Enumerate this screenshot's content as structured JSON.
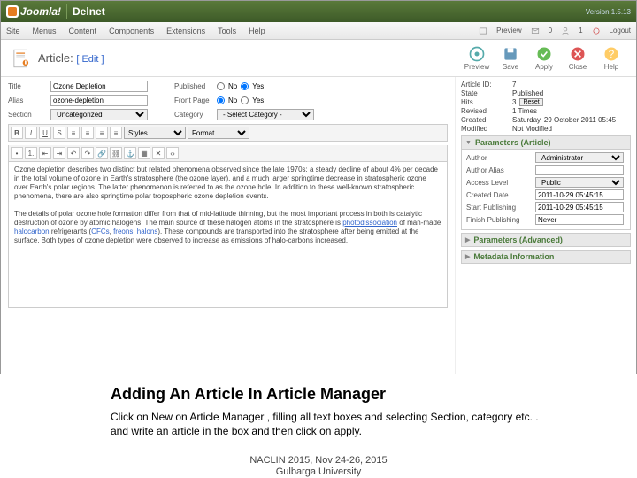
{
  "topbar": {
    "brand": "Joomla!",
    "brand2": "Delnet",
    "version": "Version 1.5.13"
  },
  "menubar": {
    "items": [
      "Site",
      "Menus",
      "Content",
      "Components",
      "Extensions",
      "Tools",
      "Help"
    ],
    "preview": "Preview",
    "msgcount": "0",
    "userscount": "1",
    "logout": "Logout"
  },
  "header": {
    "title": "Article:",
    "mode": "[ Edit ]"
  },
  "toolbar": {
    "preview": "Preview",
    "save": "Save",
    "apply": "Apply",
    "close": "Close",
    "help": "Help"
  },
  "fields": {
    "title_label": "Title",
    "title_value": "Ozone Depletion",
    "alias_label": "Alias",
    "alias_value": "ozone-depletion",
    "section_label": "Section",
    "section_value": "Uncategorized",
    "published_label": "Published",
    "frontpage_label": "Front Page",
    "category_label": "Category",
    "category_value": "- Select Category -",
    "no": "No",
    "yes": "Yes"
  },
  "meta": {
    "articleid_k": "Article ID:",
    "articleid_v": "7",
    "state_k": "State",
    "state_v": "Published",
    "hits_k": "Hits",
    "hits_v": "3",
    "reset": "Reset",
    "revised_k": "Revised",
    "revised_v": "1 Times",
    "created_k": "Created",
    "created_v": "Saturday, 29 October 2011 05:45",
    "modified_k": "Modified",
    "modified_v": "Not Modified"
  },
  "params": {
    "h1": "Parameters (Article)",
    "h2": "Parameters (Advanced)",
    "h3": "Metadata Information",
    "author_k": "Author",
    "author_v": "Administrator",
    "alias_k": "Author Alias",
    "alias_v": "",
    "access_k": "Access Level",
    "access_v": "Public",
    "created_k": "Created Date",
    "created_v": "2011-10-29 05:45:15",
    "start_k": "Start Publishing",
    "start_v": "2011-10-29 05:45:15",
    "finish_k": "Finish Publishing",
    "finish_v": "Never"
  },
  "editor": {
    "styles": "Styles",
    "format": "Format",
    "p1": "Ozone depletion describes two distinct but related phenomena observed since the late 1970s: a steady decline of about 4% per decade in the total volume of ozone in Earth's stratosphere (the ozone layer), and a much larger springtime decrease in stratospheric ozone over Earth's polar regions. The latter phenomenon is referred to as the ozone hole. In addition to these well-known stratospheric phenomena, there are also springtime polar tropospheric ozone depletion events.",
    "p2a": "The details of polar ozone hole formation differ from that of mid-latitude thinning, but the most important process in both is catalytic destruction of ozone by atomic halogens. The main source of these halogen atoms in the stratosphere is ",
    "link1": "photodissociation",
    "p2b": " of man-made ",
    "link2": "halocarbon",
    "p2c": " refrigerants (",
    "link3": "CFCs",
    "p2d": ", ",
    "link4": "freons",
    "p2e": ", ",
    "link5": "halons",
    "p2f": "). These compounds are transported into the stratosphere after being emitted at the surface. Both types of ozone depletion were observed to increase as emissions of halo-carbons increased."
  },
  "slide": {
    "title": "Adding An Article In Article Manager",
    "desc": "Click on New on Article Manager , filling all text boxes and selecting Section, category etc. . and write an article in the box and then click on apply.",
    "foot1": "NACLIN 2015, Nov 24-26, 2015",
    "foot2": "Gulbarga University"
  }
}
